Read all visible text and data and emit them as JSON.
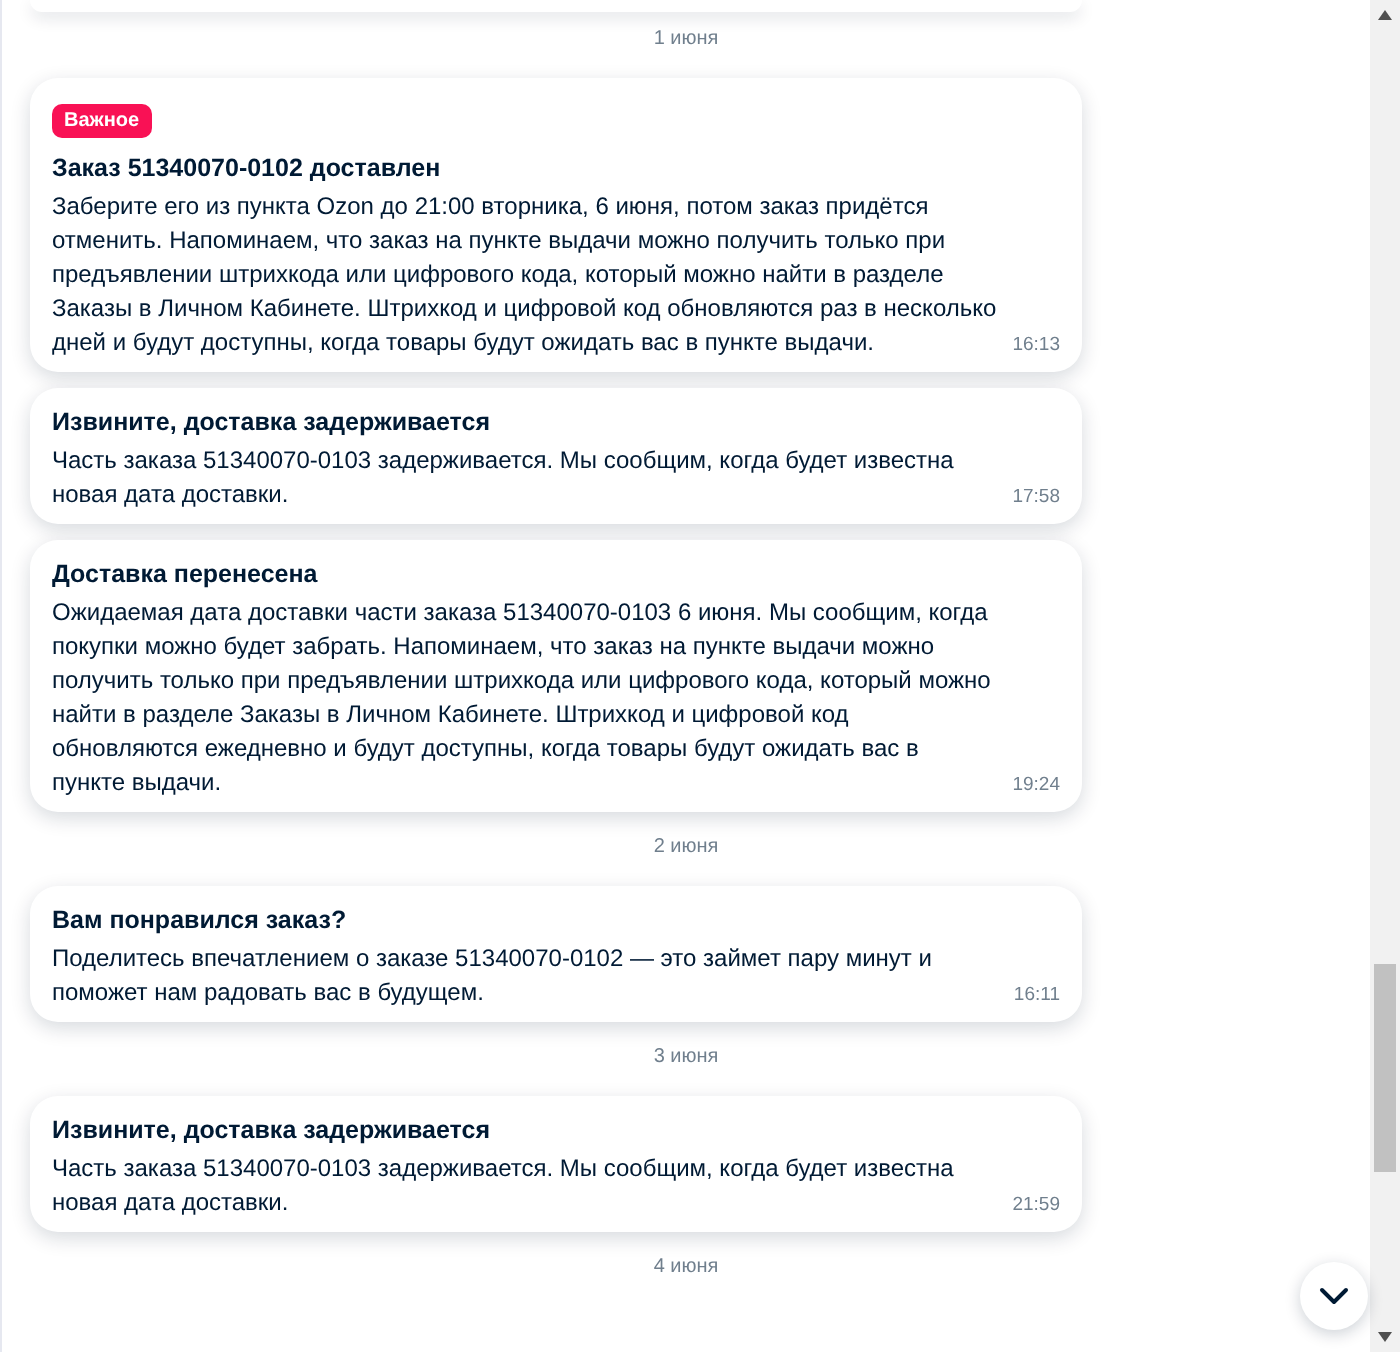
{
  "feed": [
    {
      "kind": "date",
      "text": "1 июня"
    },
    {
      "kind": "message",
      "badge": "Важное",
      "title": "Заказ 51340070-0102 доставлен",
      "body": "Заберите его из пункта Ozon до 21:00 вторника, 6 июня, потом заказ придётся отменить. Напоминаем, что заказ на пункте выдачи можно получить только при предъявлении штрихкода или цифрового кода, который можно найти в разделе Заказы в Личном Кабинете. Штрихкод и цифровой код обновляются раз в несколько дней и будут доступны, когда товары будут ожидать вас в пункте выдачи.",
      "time": "16:13"
    },
    {
      "kind": "message",
      "title": "Извините, доставка задерживается",
      "body": "Часть заказа 51340070-0103 задерживается. Мы сообщим, когда будет известна новая дата доставки.",
      "time": "17:58"
    },
    {
      "kind": "message",
      "title": "Доставка перенесена",
      "body": "Ожидаемая дата доставки части заказа 51340070-0103 6 июня. Мы сообщим, когда покупки можно будет забрать. Напоминаем, что заказ на пункте выдачи можно получить только при предъявлении штрихкода или цифрового кода, который можно найти в разделе Заказы в Личном Кабинете. Штрихкод и цифровой код обновляются ежедневно и будут доступны, когда товары будут ожидать вас в пункте выдачи.",
      "time": "19:24"
    },
    {
      "kind": "date",
      "text": "2 июня"
    },
    {
      "kind": "message",
      "title": "Вам понравился заказ?",
      "body": "Поделитесь впечатлением о заказе 51340070-0102 — это займет пару минут и поможет нам радовать вас в будущем.",
      "time": "16:11"
    },
    {
      "kind": "date",
      "text": "3 июня"
    },
    {
      "kind": "message",
      "title": "Извините, доставка задерживается",
      "body": "Часть заказа 51340070-0103 задерживается. Мы сообщим, когда будет известна новая дата доставки.",
      "time": "21:59"
    },
    {
      "kind": "date",
      "text": "4 июня"
    }
  ]
}
